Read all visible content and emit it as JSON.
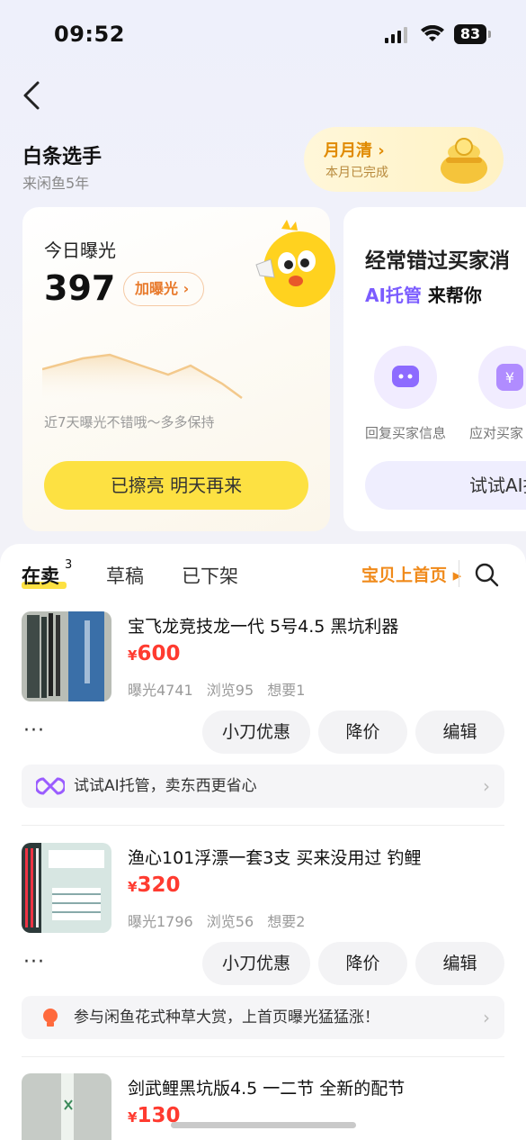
{
  "status": {
    "time": "09:52",
    "battery": "83"
  },
  "profile": {
    "name": "白条选手",
    "since": "来闲鱼5年"
  },
  "monthly": {
    "title": "月月清 ›",
    "subtitle": "本月已完成"
  },
  "exposure_card": {
    "label": "今日曝光",
    "value": "397",
    "boost_button": "加曝光 ›",
    "trend_tip": "近7天曝光不错哦～多多保持",
    "action": "已擦亮 明天再来"
  },
  "ai_card": {
    "title": "经常错过买家消",
    "ai_prefix": "AI托管",
    "ai_suffix": " 来帮你",
    "feature1": "回复买家信息",
    "feature2": "应对买家",
    "button": "试试AI托"
  },
  "tabs": {
    "selling": "在卖",
    "selling_count": "3",
    "drafts": "草稿",
    "offline": "已下架",
    "homepage_link": "宝贝上首页 ▸"
  },
  "items": [
    {
      "title": "宝飞龙竞技龙一代 5号4.5 黑坑利器",
      "currency": "¥",
      "price": "600",
      "stats": "曝光4741 浏览95 想要1",
      "btn_discount": "小刀优惠",
      "btn_reduce": "降价",
      "btn_edit": "编辑",
      "more": "···",
      "banner": "试试AI托管，卖东西更省心",
      "banner_icon": "ai-infinity-icon"
    },
    {
      "title": "渔心101浮漂一套3支 买来没用过 钓鲤",
      "currency": "¥",
      "price": "320",
      "stats": "曝光1796 浏览56 想要2",
      "btn_discount": "小刀优惠",
      "btn_reduce": "降价",
      "btn_edit": "编辑",
      "more": "···",
      "banner": "参与闲鱼花式种草大赏，上首页曝光猛猛涨！",
      "banner_icon": "lightbulb-icon"
    },
    {
      "title": "剑武鲤黑坑版4.5 一二节 全新的配节",
      "currency": "¥",
      "price": "130"
    }
  ],
  "colors": {
    "accent_yellow": "#fde142",
    "price_red": "#ff3b30",
    "orange": "#f08a1a"
  }
}
